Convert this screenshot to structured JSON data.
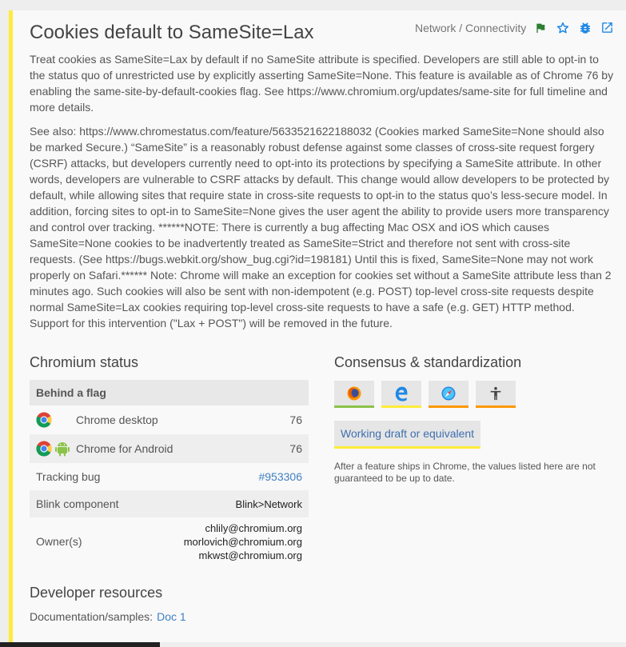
{
  "feature": {
    "title": "Cookies default to SameSite=Lax",
    "category": "Network / Connectivity",
    "description": "Treat cookies as SameSite=Lax by default if no SameSite attribute is specified. Developers are still able to opt-in to the status quo of unrestricted use by explicitly asserting SameSite=None. This feature is available as of Chrome 76 by enabling the same-site-by-default-cookies flag. See https://www.chromium.org/updates/same-site for full timeline and more details.",
    "see_also": "See also: https://www.chromestatus.com/feature/5633521622188032 (Cookies marked SameSite=None should also be marked Secure.) “SameSite” is a reasonably robust defense against some classes of cross-site request forgery (CSRF) attacks, but developers currently need to opt-into its protections by specifying a SameSite attribute. In other words, developers are vulnerable to CSRF attacks by default. This change would allow developers to be protected by default, while allowing sites that require state in cross-site requests to opt-in to the status quo’s less-secure model. In addition, forcing sites to opt-in to SameSite=None gives the user agent the ability to provide users more transparency and control over tracking. ******NOTE: There is currently a bug affecting Mac OSX and iOS which causes SameSite=None cookies to be inadvertently treated as SameSite=Strict and therefore not sent with cross-site requests. (See https://bugs.webkit.org/show_bug.cgi?id=198181) Until this is fixed, SameSite=None may not work properly on Safari.****** Note: Chrome will make an exception for cookies set without a SameSite attribute less than 2 minutes ago. Such cookies will also be sent with non-idempotent (e.g. POST) top-level cross-site requests despite normal SameSite=Lax cookies requiring top-level cross-site requests to have a safe (e.g. GET) HTTP method. Support for this intervention (\"Lax + POST\") will be removed in the future."
  },
  "actions": {
    "flag_icon": "flag-icon",
    "star_icon": "star-icon",
    "bug_icon": "bug-icon",
    "open_icon": "open-in-new-icon"
  },
  "chromium_status": {
    "heading": "Chromium status",
    "state": "Behind a flag",
    "platforms": [
      {
        "name": "Chrome desktop",
        "version": "76",
        "icons": [
          "chrome-icon"
        ]
      },
      {
        "name": "Chrome for Android",
        "version": "76",
        "icons": [
          "chrome-icon",
          "android-icon"
        ]
      }
    ],
    "tracking_bug_label": "Tracking bug",
    "tracking_bug_value": "#953306",
    "blink_component_label": "Blink component",
    "blink_component_value": "Blink>Network",
    "owners_label": "Owner(s)",
    "owners": [
      "chlily@chromium.org",
      "morlovich@chromium.org",
      "mkwst@chromium.org"
    ]
  },
  "consensus": {
    "heading": "Consensus & standardization",
    "browsers": [
      {
        "icon": "firefox-icon",
        "color": "#8bc34a"
      },
      {
        "icon": "edge-icon",
        "color": "#ffeb3b"
      },
      {
        "icon": "safari-icon",
        "color": "#ff9800"
      },
      {
        "icon": "accessibility-icon",
        "color": "#ff9800"
      }
    ],
    "standard_status": "Working draft or equivalent",
    "note": "After a feature ships in Chrome, the values listed here are not guaranteed to be up to date."
  },
  "developer_resources": {
    "heading": "Developer resources",
    "docs_label": "Documentation/samples:",
    "docs_link": "Doc 1"
  },
  "colors": {
    "accent": "#ffeb3b",
    "link": "#3f7fc2",
    "flag_green": "#2e7d32",
    "icon_blue": "#1e88e5"
  }
}
